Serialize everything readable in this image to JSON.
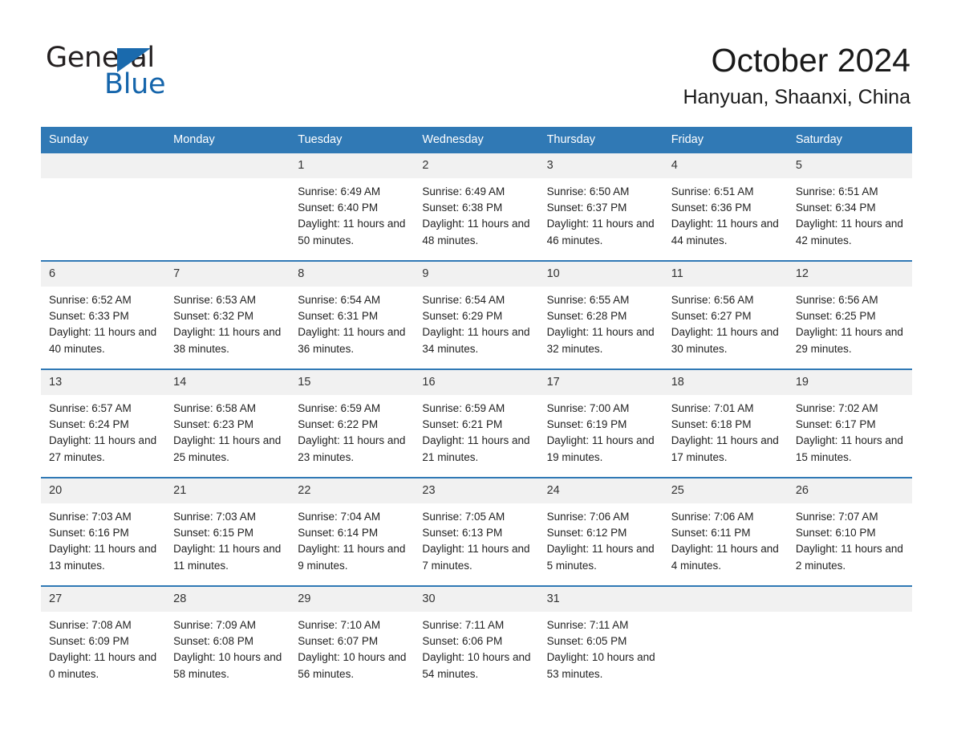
{
  "brand": {
    "name_part1": "General",
    "name_part2": "Blue",
    "accent_color": "#1565ab",
    "triangle_icon": "triangle-icon"
  },
  "header": {
    "month_title": "October 2024",
    "location": "Hanyuan, Shaanxi, China"
  },
  "calendar": {
    "header_bg": "#3079b5",
    "daynum_bg": "#f1f1f1",
    "weekdays": [
      "Sunday",
      "Monday",
      "Tuesday",
      "Wednesday",
      "Thursday",
      "Friday",
      "Saturday"
    ],
    "weeks": [
      [
        {
          "day": "",
          "empty": true
        },
        {
          "day": "",
          "empty": true
        },
        {
          "day": "1",
          "sunrise": "Sunrise: 6:49 AM",
          "sunset": "Sunset: 6:40 PM",
          "daylight": "Daylight: 11 hours and 50 minutes."
        },
        {
          "day": "2",
          "sunrise": "Sunrise: 6:49 AM",
          "sunset": "Sunset: 6:38 PM",
          "daylight": "Daylight: 11 hours and 48 minutes."
        },
        {
          "day": "3",
          "sunrise": "Sunrise: 6:50 AM",
          "sunset": "Sunset: 6:37 PM",
          "daylight": "Daylight: 11 hours and 46 minutes."
        },
        {
          "day": "4",
          "sunrise": "Sunrise: 6:51 AM",
          "sunset": "Sunset: 6:36 PM",
          "daylight": "Daylight: 11 hours and 44 minutes."
        },
        {
          "day": "5",
          "sunrise": "Sunrise: 6:51 AM",
          "sunset": "Sunset: 6:34 PM",
          "daylight": "Daylight: 11 hours and 42 minutes."
        }
      ],
      [
        {
          "day": "6",
          "sunrise": "Sunrise: 6:52 AM",
          "sunset": "Sunset: 6:33 PM",
          "daylight": "Daylight: 11 hours and 40 minutes."
        },
        {
          "day": "7",
          "sunrise": "Sunrise: 6:53 AM",
          "sunset": "Sunset: 6:32 PM",
          "daylight": "Daylight: 11 hours and 38 minutes."
        },
        {
          "day": "8",
          "sunrise": "Sunrise: 6:54 AM",
          "sunset": "Sunset: 6:31 PM",
          "daylight": "Daylight: 11 hours and 36 minutes."
        },
        {
          "day": "9",
          "sunrise": "Sunrise: 6:54 AM",
          "sunset": "Sunset: 6:29 PM",
          "daylight": "Daylight: 11 hours and 34 minutes."
        },
        {
          "day": "10",
          "sunrise": "Sunrise: 6:55 AM",
          "sunset": "Sunset: 6:28 PM",
          "daylight": "Daylight: 11 hours and 32 minutes."
        },
        {
          "day": "11",
          "sunrise": "Sunrise: 6:56 AM",
          "sunset": "Sunset: 6:27 PM",
          "daylight": "Daylight: 11 hours and 30 minutes."
        },
        {
          "day": "12",
          "sunrise": "Sunrise: 6:56 AM",
          "sunset": "Sunset: 6:25 PM",
          "daylight": "Daylight: 11 hours and 29 minutes."
        }
      ],
      [
        {
          "day": "13",
          "sunrise": "Sunrise: 6:57 AM",
          "sunset": "Sunset: 6:24 PM",
          "daylight": "Daylight: 11 hours and 27 minutes."
        },
        {
          "day": "14",
          "sunrise": "Sunrise: 6:58 AM",
          "sunset": "Sunset: 6:23 PM",
          "daylight": "Daylight: 11 hours and 25 minutes."
        },
        {
          "day": "15",
          "sunrise": "Sunrise: 6:59 AM",
          "sunset": "Sunset: 6:22 PM",
          "daylight": "Daylight: 11 hours and 23 minutes."
        },
        {
          "day": "16",
          "sunrise": "Sunrise: 6:59 AM",
          "sunset": "Sunset: 6:21 PM",
          "daylight": "Daylight: 11 hours and 21 minutes."
        },
        {
          "day": "17",
          "sunrise": "Sunrise: 7:00 AM",
          "sunset": "Sunset: 6:19 PM",
          "daylight": "Daylight: 11 hours and 19 minutes."
        },
        {
          "day": "18",
          "sunrise": "Sunrise: 7:01 AM",
          "sunset": "Sunset: 6:18 PM",
          "daylight": "Daylight: 11 hours and 17 minutes."
        },
        {
          "day": "19",
          "sunrise": "Sunrise: 7:02 AM",
          "sunset": "Sunset: 6:17 PM",
          "daylight": "Daylight: 11 hours and 15 minutes."
        }
      ],
      [
        {
          "day": "20",
          "sunrise": "Sunrise: 7:03 AM",
          "sunset": "Sunset: 6:16 PM",
          "daylight": "Daylight: 11 hours and 13 minutes."
        },
        {
          "day": "21",
          "sunrise": "Sunrise: 7:03 AM",
          "sunset": "Sunset: 6:15 PM",
          "daylight": "Daylight: 11 hours and 11 minutes."
        },
        {
          "day": "22",
          "sunrise": "Sunrise: 7:04 AM",
          "sunset": "Sunset: 6:14 PM",
          "daylight": "Daylight: 11 hours and 9 minutes."
        },
        {
          "day": "23",
          "sunrise": "Sunrise: 7:05 AM",
          "sunset": "Sunset: 6:13 PM",
          "daylight": "Daylight: 11 hours and 7 minutes."
        },
        {
          "day": "24",
          "sunrise": "Sunrise: 7:06 AM",
          "sunset": "Sunset: 6:12 PM",
          "daylight": "Daylight: 11 hours and 5 minutes."
        },
        {
          "day": "25",
          "sunrise": "Sunrise: 7:06 AM",
          "sunset": "Sunset: 6:11 PM",
          "daylight": "Daylight: 11 hours and 4 minutes."
        },
        {
          "day": "26",
          "sunrise": "Sunrise: 7:07 AM",
          "sunset": "Sunset: 6:10 PM",
          "daylight": "Daylight: 11 hours and 2 minutes."
        }
      ],
      [
        {
          "day": "27",
          "sunrise": "Sunrise: 7:08 AM",
          "sunset": "Sunset: 6:09 PM",
          "daylight": "Daylight: 11 hours and 0 minutes."
        },
        {
          "day": "28",
          "sunrise": "Sunrise: 7:09 AM",
          "sunset": "Sunset: 6:08 PM",
          "daylight": "Daylight: 10 hours and 58 minutes."
        },
        {
          "day": "29",
          "sunrise": "Sunrise: 7:10 AM",
          "sunset": "Sunset: 6:07 PM",
          "daylight": "Daylight: 10 hours and 56 minutes."
        },
        {
          "day": "30",
          "sunrise": "Sunrise: 7:11 AM",
          "sunset": "Sunset: 6:06 PM",
          "daylight": "Daylight: 10 hours and 54 minutes."
        },
        {
          "day": "31",
          "sunrise": "Sunrise: 7:11 AM",
          "sunset": "Sunset: 6:05 PM",
          "daylight": "Daylight: 10 hours and 53 minutes."
        },
        {
          "day": "",
          "empty": true
        },
        {
          "day": "",
          "empty": true
        }
      ]
    ]
  }
}
